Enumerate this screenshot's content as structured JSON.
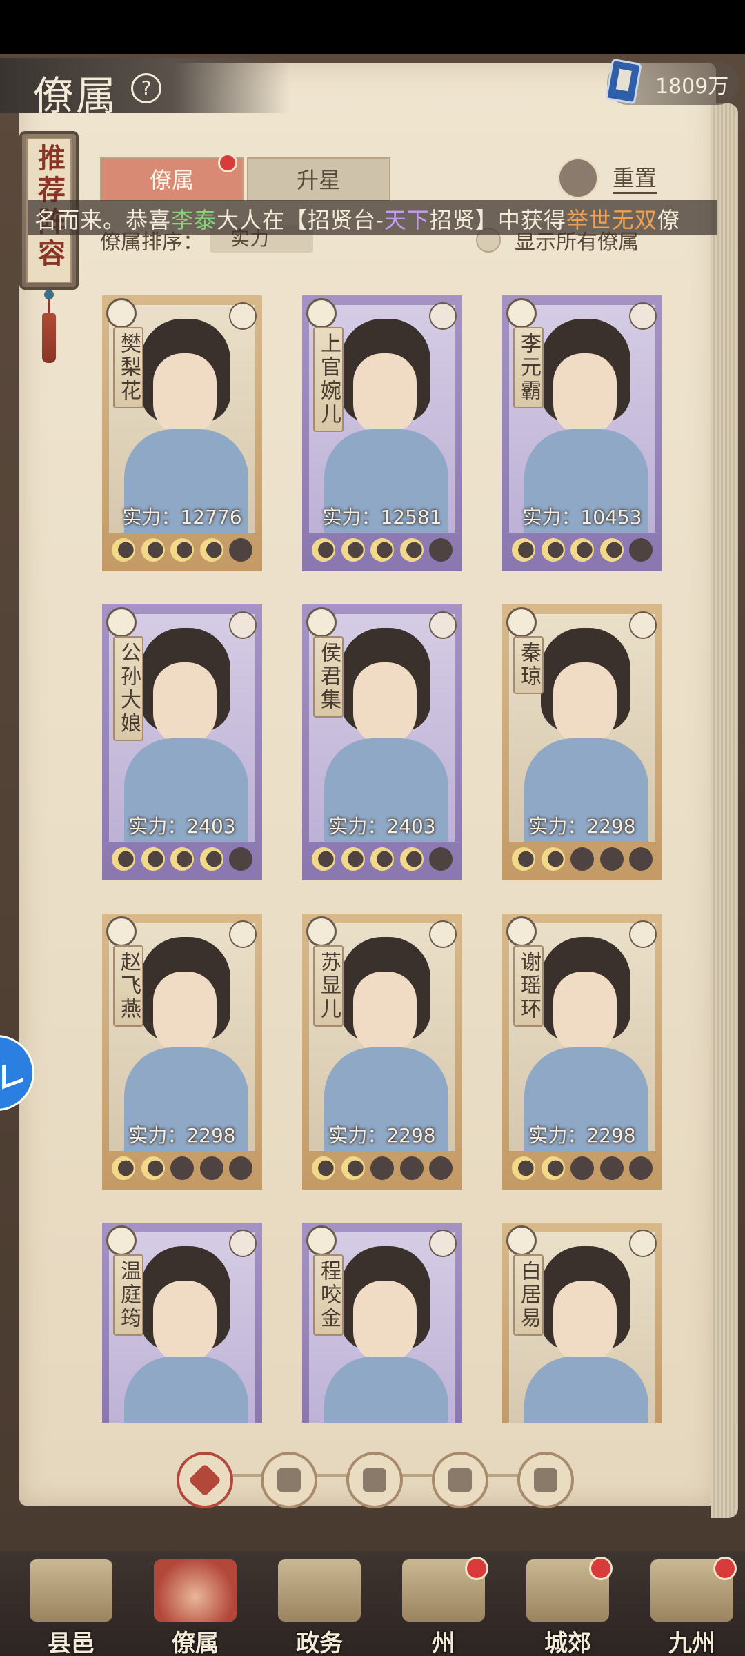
{
  "header": {
    "title": "僚属",
    "help_icon": "?",
    "currency_value": "1809万"
  },
  "side_tab": {
    "label": "推荐阵容"
  },
  "tabs": [
    {
      "label": "僚属",
      "active": true
    },
    {
      "label": "升星",
      "active": false
    }
  ],
  "reset": {
    "label": "重置"
  },
  "sort": {
    "label": "僚属排序：",
    "value": "实力"
  },
  "show_all": {
    "label": "显示所有僚属"
  },
  "marquee": {
    "part1": "名而来。恭喜",
    "name": "李泰",
    "part2": "大人在【招贤台-",
    "source": "天下",
    "part3": "招贤】中获得",
    "item": "举世无双",
    "part4": "僚"
  },
  "officers": [
    {
      "name": "樊梨花",
      "power_label": "实力：12776",
      "power": 12776,
      "stars": 4,
      "rarity": "gold"
    },
    {
      "name": "上官婉儿",
      "power_label": "实力：12581",
      "power": 12581,
      "stars": 4,
      "rarity": "purple"
    },
    {
      "name": "李元霸",
      "power_label": "实力：10453",
      "power": 10453,
      "stars": 4,
      "rarity": "purple"
    },
    {
      "name": "公孙大娘",
      "power_label": "实力：2403",
      "power": 2403,
      "stars": 4,
      "rarity": "purple"
    },
    {
      "name": "侯君集",
      "power_label": "实力：2403",
      "power": 2403,
      "stars": 4,
      "rarity": "purple"
    },
    {
      "name": "秦琼",
      "power_label": "实力：2298",
      "power": 2298,
      "stars": 2,
      "rarity": "gold"
    },
    {
      "name": "赵飞燕",
      "power_label": "实力：2298",
      "power": 2298,
      "stars": 2,
      "rarity": "gold"
    },
    {
      "name": "苏显儿",
      "power_label": "实力：2298",
      "power": 2298,
      "stars": 2,
      "rarity": "gold"
    },
    {
      "name": "谢瑶环",
      "power_label": "实力：2298",
      "power": 2298,
      "stars": 2,
      "rarity": "gold"
    },
    {
      "name": "温庭筠",
      "power_label": "",
      "power": null,
      "stars": null,
      "rarity": "purple"
    },
    {
      "name": "程咬金",
      "power_label": "",
      "power": null,
      "stars": null,
      "rarity": "purple"
    },
    {
      "name": "白居易",
      "power_label": "",
      "power": null,
      "stars": null,
      "rarity": "gold"
    }
  ],
  "filters": [
    {
      "icon": "all-filter-icon",
      "active": true
    },
    {
      "icon": "literati-filter-icon",
      "active": false
    },
    {
      "icon": "official-filter-icon",
      "active": false
    },
    {
      "icon": "beauty-filter-icon",
      "active": false
    },
    {
      "icon": "general-filter-icon",
      "active": false
    }
  ],
  "bottom_nav": [
    {
      "label": "县邑",
      "dot": false,
      "active": false
    },
    {
      "label": "僚属",
      "dot": false,
      "active": true
    },
    {
      "label": "政务",
      "dot": false,
      "active": false
    },
    {
      "label": "州",
      "dot": true,
      "active": false
    },
    {
      "label": "城郊",
      "dot": true,
      "active": false
    },
    {
      "label": "九州",
      "dot": true,
      "active": false
    }
  ],
  "colors": {
    "accent_red": "#b3473a",
    "paper": "#efe4cf",
    "moon_lit": "#f2d98a",
    "rarity_purple": "#8a77b0",
    "rarity_gold": "#c49a66"
  }
}
